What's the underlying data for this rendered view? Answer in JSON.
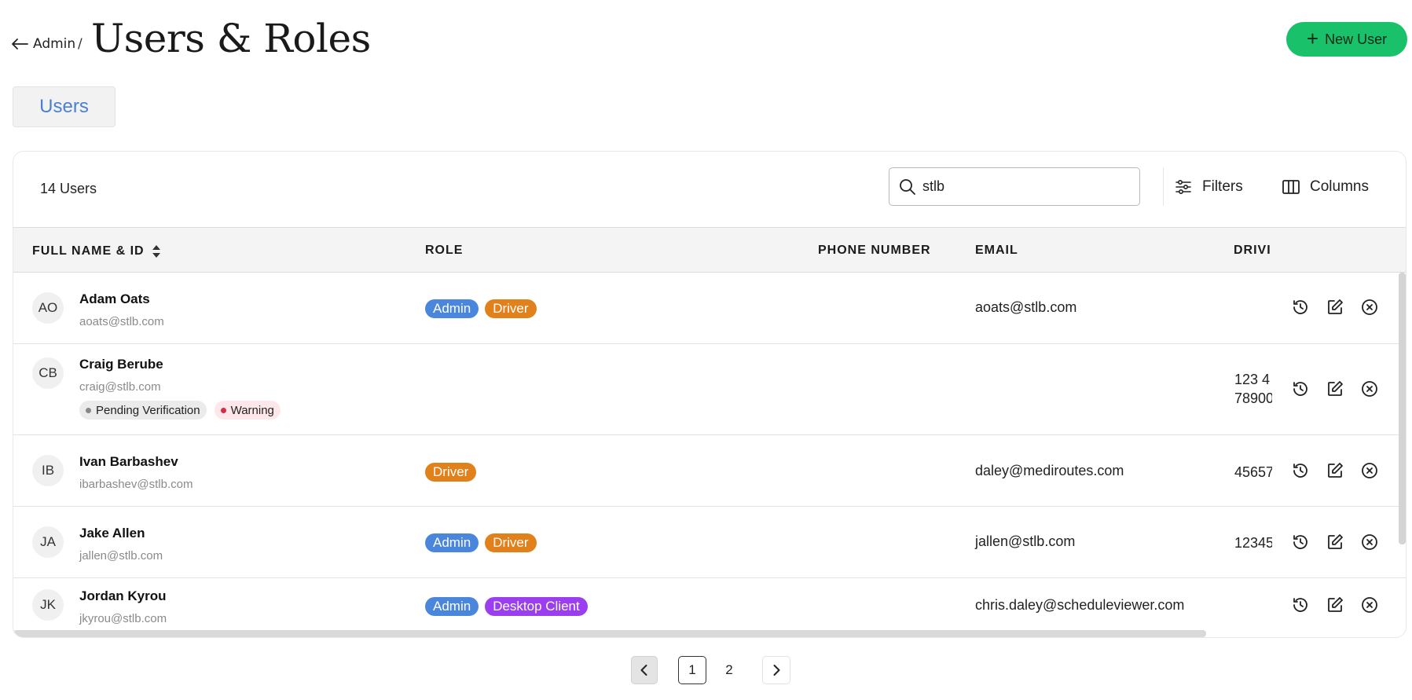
{
  "header": {
    "back_label": "Admin",
    "separator": "/",
    "title": "Users & Roles",
    "new_user_label": "New User"
  },
  "tabs": [
    {
      "label": "Users",
      "active": true
    }
  ],
  "toolbar": {
    "count_label": "14 Users",
    "search_value": "stlb",
    "filters_label": "Filters",
    "columns_label": "Columns"
  },
  "table": {
    "columns": [
      "FULL NAME & ID",
      "ROLE",
      "PHONE NUMBER",
      "EMAIL",
      "DRIVI"
    ],
    "rows": [
      {
        "initials": "AO",
        "name": "Adam Oats",
        "login": "aoats@stlb.com",
        "roles": [
          "Admin",
          "Driver"
        ],
        "phone": "",
        "email": "aoats@stlb.com",
        "driver": ""
      },
      {
        "initials": "CB",
        "name": "Craig Berube",
        "login": "craig@stlb.com",
        "roles": [],
        "tags": [
          "Pending Verification",
          "Warning"
        ],
        "phone": "",
        "email": "",
        "driver_line1": "123 4",
        "driver_line2": "78900"
      },
      {
        "initials": "IB",
        "name": "Ivan Barbashev",
        "login": "ibarbashev@stlb.com",
        "roles": [
          "Driver"
        ],
        "phone": "",
        "email": "daley@mediroutes.com",
        "driver": "45657"
      },
      {
        "initials": "JA",
        "name": "Jake Allen",
        "login": "jallen@stlb.com",
        "roles": [
          "Admin",
          "Driver"
        ],
        "phone": "",
        "email": "jallen@stlb.com",
        "driver": "12345"
      },
      {
        "initials": "JK",
        "name": "Jordan Kyrou",
        "login": "jkyrou@stlb.com",
        "roles": [
          "Admin",
          "Desktop Client"
        ],
        "phone": "",
        "email": "chris.daley@scheduleviewer.com",
        "driver": ""
      }
    ]
  },
  "pagination": {
    "pages": [
      "1",
      "2"
    ],
    "current": "1"
  },
  "colors": {
    "accent_green": "#19c16b",
    "admin_badge": "#4a87dc",
    "driver_badge": "#e0811c",
    "desktop_badge": "#9a3ef0",
    "tab_text": "#4a7fd6"
  }
}
